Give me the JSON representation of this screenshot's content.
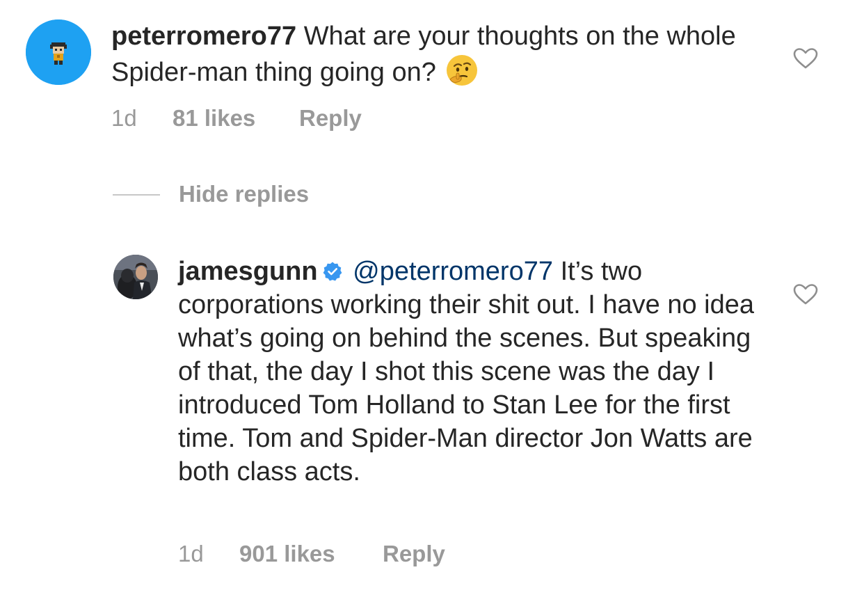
{
  "comments": [
    {
      "username": "peterromero77",
      "text": "What are your thoughts on the whole Spider-man thing going on?",
      "emoji": "thinking-face-icon",
      "time": "1d",
      "likes": "81 likes",
      "reply_label": "Reply"
    },
    {
      "username": "jamesgunn",
      "verified": true,
      "mention": "@peterromero77",
      "text": "It’s two corporations working their shit out. I have no idea what’s going on behind the scenes. But speaking of that, the day I shot this scene was the day I introduced Tom Holland to Stan Lee for the first time. Tom and Spider-Man director Jon Watts are both class acts.",
      "time": "1d",
      "likes": "901 likes",
      "reply_label": "Reply"
    }
  ],
  "thread": {
    "hide_replies_label": "Hide replies"
  },
  "icons": {
    "like": "heart-outline-icon",
    "verified": "verified-badge-icon"
  },
  "colors": {
    "text": "#262626",
    "meta": "#999999",
    "mention": "#003569",
    "verified_badge": "#3897f0",
    "avatar_bg": "#1ea1f2"
  }
}
